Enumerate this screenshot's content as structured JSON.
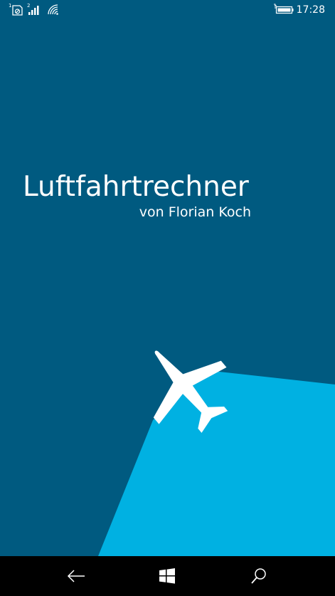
{
  "status_bar": {
    "sim1_label": "1",
    "sim2_label": "2",
    "time": "17:28",
    "icons": [
      "sim1-no-signal-icon",
      "sim2-signal-icon",
      "wifi-icon",
      "battery-charging-icon"
    ]
  },
  "splash": {
    "title": "Luftfahrtrechner",
    "subtitle": "von Florian Koch"
  },
  "nav_bar": {
    "icons": [
      "back-arrow-icon",
      "windows-start-icon",
      "search-icon"
    ]
  },
  "colors": {
    "background": "#005a80",
    "light_beam": "#00b1e2",
    "airplane": "#ffffff",
    "nav_bar": "#000000"
  }
}
